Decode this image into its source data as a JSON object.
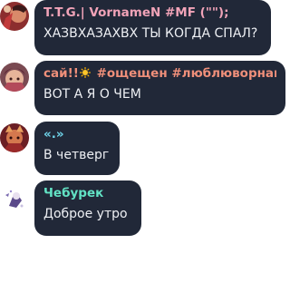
{
  "messages": [
    {
      "sender": "T.T.G.| VornameN #MF (\"\");",
      "text": "ХАЗВХАЗАХВХ ТЫ КОГДА СПАЛ?",
      "sender_color": "#f1a3b8",
      "avatar_icon": "avatar-anime-icon"
    },
    {
      "sender_before": "сай!!",
      "sender_emoji": "sun-emoji-icon",
      "sender_after": " #ощещен #люблюворнаме",
      "text": "ВОТ А Я О ЧЕМ",
      "sender_color": "#ef8f7a",
      "avatar_icon": "avatar-anime-icon"
    },
    {
      "sender": "«.»",
      "text": "В четверг",
      "sender_color": "#6fd4ea",
      "avatar_icon": "avatar-anime-icon"
    },
    {
      "sender": "Чебурек",
      "text": "Доброе утро",
      "sender_color": "#62e2c4",
      "avatar_icon": "avatar-sticker-icon"
    }
  ],
  "colors": {
    "bubble_bg": "#212838",
    "message_text": "#eef0f4"
  }
}
